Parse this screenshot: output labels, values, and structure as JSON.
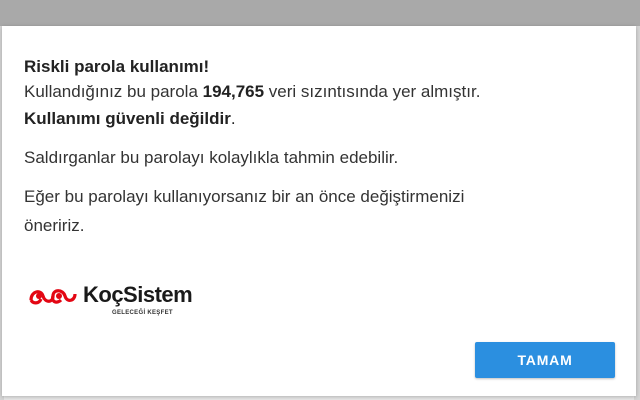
{
  "dialog": {
    "title": "Riskli parola kullanımı!",
    "line2_prefix": "Kullandığınız bu parola ",
    "leak_count": "194,765",
    "line2_suffix": " veri sızıntısında yer almıştır.",
    "line3_bold": "Kullanımı güvenli değildir",
    "line3_dot": ".",
    "line4": "Saldırganlar bu parolayı kolaylıkla tahmin edebilir.",
    "line5": "Eğer bu parolayı kullanıyorsanız bir an önce değiştirmenizi",
    "line6": "öneririz.",
    "ok_label": "TAMAM"
  },
  "logo": {
    "name": "KoçSistem",
    "tagline": "GELECEĞİ KEŞFET",
    "mark_color": "#e30613"
  },
  "colors": {
    "button": "#2b8fe0",
    "text": "#333333"
  }
}
